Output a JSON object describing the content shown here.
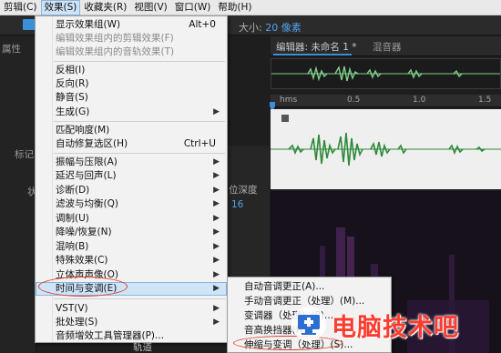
{
  "menubar": {
    "items": [
      "剪辑(C)",
      "效果(S)",
      "收藏夹(R)",
      "视图(V)",
      "窗口(W)",
      "帮助(H)"
    ]
  },
  "toolbar": {
    "size_label": "大小:",
    "size_value": "20 像素"
  },
  "left_panel": {
    "properties_label": "属性",
    "markers_label": "标记",
    "status_label": "状"
  },
  "mid_panel": {
    "bit_depth_label": "位深度",
    "bit_depth_value": "16"
  },
  "editor": {
    "tab_editor": "编辑器: 未命名 1 *",
    "tab_mixer": "混音器",
    "ruler_ticks": [
      "hms",
      "0.5",
      "1.0",
      "1.5"
    ]
  },
  "effects_menu": {
    "items": [
      {
        "label": "显示效果组(W)",
        "shortcut": "Alt+0",
        "disabled": false,
        "submenu": false
      },
      {
        "label": "编辑效果组内的剪辑效果(F)",
        "shortcut": "",
        "disabled": true,
        "submenu": false
      },
      {
        "label": "编辑效果组内的音轨效果(T)",
        "shortcut": "",
        "disabled": true,
        "submenu": false
      },
      {
        "label": "反相(I)",
        "shortcut": "",
        "disabled": false,
        "submenu": false
      },
      {
        "label": "反向(R)",
        "shortcut": "",
        "disabled": false,
        "submenu": false
      },
      {
        "label": "静音(S)",
        "shortcut": "",
        "disabled": false,
        "submenu": false
      },
      {
        "label": "生成(G)",
        "shortcut": "",
        "disabled": false,
        "submenu": true
      },
      {
        "label": "匹配响度(M)",
        "shortcut": "",
        "disabled": false,
        "submenu": false
      },
      {
        "label": "自动修复选区(H)",
        "shortcut": "Ctrl+U",
        "disabled": false,
        "submenu": false
      },
      {
        "label": "振幅与压限(A)",
        "shortcut": "",
        "disabled": false,
        "submenu": true
      },
      {
        "label": "延迟与回声(L)",
        "shortcut": "",
        "disabled": false,
        "submenu": true
      },
      {
        "label": "诊断(D)",
        "shortcut": "",
        "disabled": false,
        "submenu": true
      },
      {
        "label": "滤波与均衡(Q)",
        "shortcut": "",
        "disabled": false,
        "submenu": true
      },
      {
        "label": "调制(U)",
        "shortcut": "",
        "disabled": false,
        "submenu": true
      },
      {
        "label": "降噪/恢复(N)",
        "shortcut": "",
        "disabled": false,
        "submenu": true
      },
      {
        "label": "混响(B)",
        "shortcut": "",
        "disabled": false,
        "submenu": true
      },
      {
        "label": "特殊效果(C)",
        "shortcut": "",
        "disabled": false,
        "submenu": true
      },
      {
        "label": "立体声声像(O)",
        "shortcut": "",
        "disabled": false,
        "submenu": true
      },
      {
        "label": "时间与变调(E)",
        "shortcut": "",
        "disabled": false,
        "submenu": true
      },
      {
        "label": "VST(V)",
        "shortcut": "",
        "disabled": false,
        "submenu": true
      },
      {
        "label": "批处理(S)",
        "shortcut": "",
        "disabled": false,
        "submenu": true
      },
      {
        "label": "音频增效工具管理器(P)...",
        "shortcut": "",
        "disabled": false,
        "submenu": false
      }
    ]
  },
  "time_pitch_submenu": {
    "items": [
      "自动音调更正(A)...",
      "手动音调更正（处理）(M)...",
      "变调器（处理）(P)...",
      "音高换挡器(H)...",
      "伸缩与变调（处理）(S)..."
    ]
  },
  "bottom": {
    "tracks_label": "轨道"
  },
  "watermark": {
    "text": "电脑技术吧"
  },
  "colors": {
    "accent": "#3b8fd8",
    "highlight": "#cfe4f7",
    "annotation": "#e03a2f"
  }
}
